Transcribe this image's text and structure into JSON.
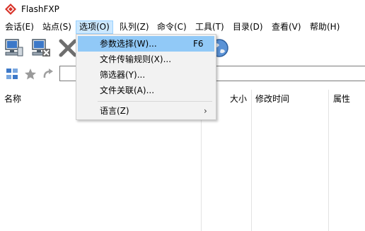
{
  "window": {
    "title": "FlashFXP",
    "logo_icon": "flashfxp-logo-icon"
  },
  "menubar": {
    "items": [
      {
        "label": "会话(E)"
      },
      {
        "label": "站点(S)"
      },
      {
        "label": "选项(O)"
      },
      {
        "label": "队列(Z)"
      },
      {
        "label": "命令(C)"
      },
      {
        "label": "工具(T)"
      },
      {
        "label": "目录(D)"
      },
      {
        "label": "查看(V)"
      },
      {
        "label": "帮助(H)"
      }
    ],
    "open_item": "选项(O)"
  },
  "toolbar": {
    "buttons": [
      {
        "icon": "connect-computer-icon"
      },
      {
        "icon": "disconnect-computer-icon"
      },
      {
        "icon": "abort-x-icon"
      },
      {
        "icon": "globe-icon"
      }
    ]
  },
  "addressbar": {
    "icons": [
      "tree-view-icon",
      "favorites-star-icon",
      "refresh-arrow-icon"
    ],
    "path_value": ""
  },
  "file_list": {
    "columns": [
      {
        "label": "名称"
      },
      {
        "label": "大小"
      },
      {
        "label": "修改时间"
      },
      {
        "label": "属性"
      }
    ]
  },
  "options_menu": {
    "items": [
      {
        "label": "参数选择(W)...",
        "shortcut": "F6",
        "highlighted": true
      },
      {
        "label": "文件传输规则(X)..."
      },
      {
        "label": "筛选器(Y)..."
      },
      {
        "label": "文件关联(A)..."
      },
      {
        "label": "语言(Z)",
        "submenu_arrow": "›"
      }
    ]
  },
  "colors": {
    "menu_highlight": "#91c9f7",
    "menubar_open": "#cce8ff",
    "menu_bg": "#f2f2f2"
  }
}
